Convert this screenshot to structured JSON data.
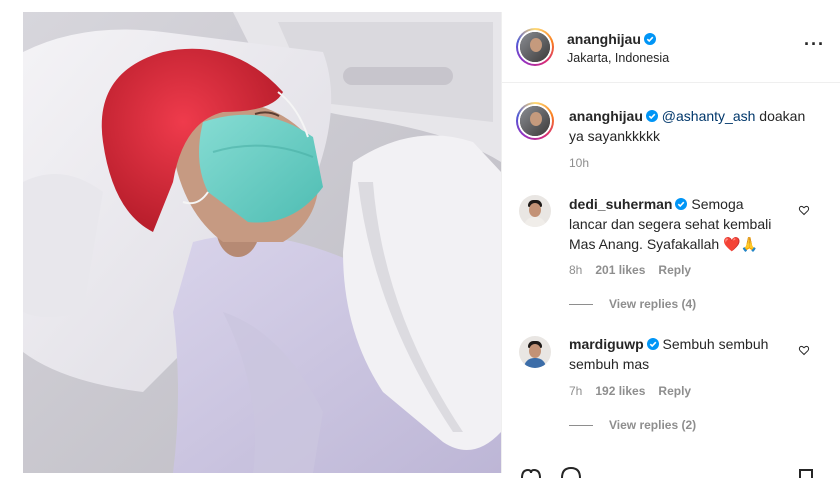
{
  "post": {
    "author": "ananghijau",
    "location": "Jakarta, Indonesia",
    "caption_mention": "@ashanty_ash",
    "caption_text_line1": " doakan",
    "caption_text_line2": "ya sayankkkkk",
    "time": "10h"
  },
  "comments": [
    {
      "username": "dedi_suherman",
      "line1": " Semoga",
      "line2": "lancar dan segera sehat kembali",
      "line3": "Mas Anang. Syafakallah ❤️🙏",
      "time": "8h",
      "likes": "201 likes",
      "reply": "Reply",
      "view_replies": "View replies (4)"
    },
    {
      "username": "mardiguwp",
      "line1": " Sembuh sembuh",
      "line2": "sembuh mas",
      "time": "7h",
      "likes": "192 likes",
      "reply": "Reply",
      "view_replies": "View replies (2)"
    }
  ],
  "icons": {
    "verified": "verified-badge-icon",
    "more": "more-options-icon",
    "like": "heart-outline-icon"
  },
  "colors": {
    "verified_blue": "#0095f6",
    "text": "#262626",
    "secondary": "#8e8e8e",
    "mention": "#00376b",
    "hat_red": "#d62a3a",
    "mask_teal": "#6fd0c8"
  }
}
